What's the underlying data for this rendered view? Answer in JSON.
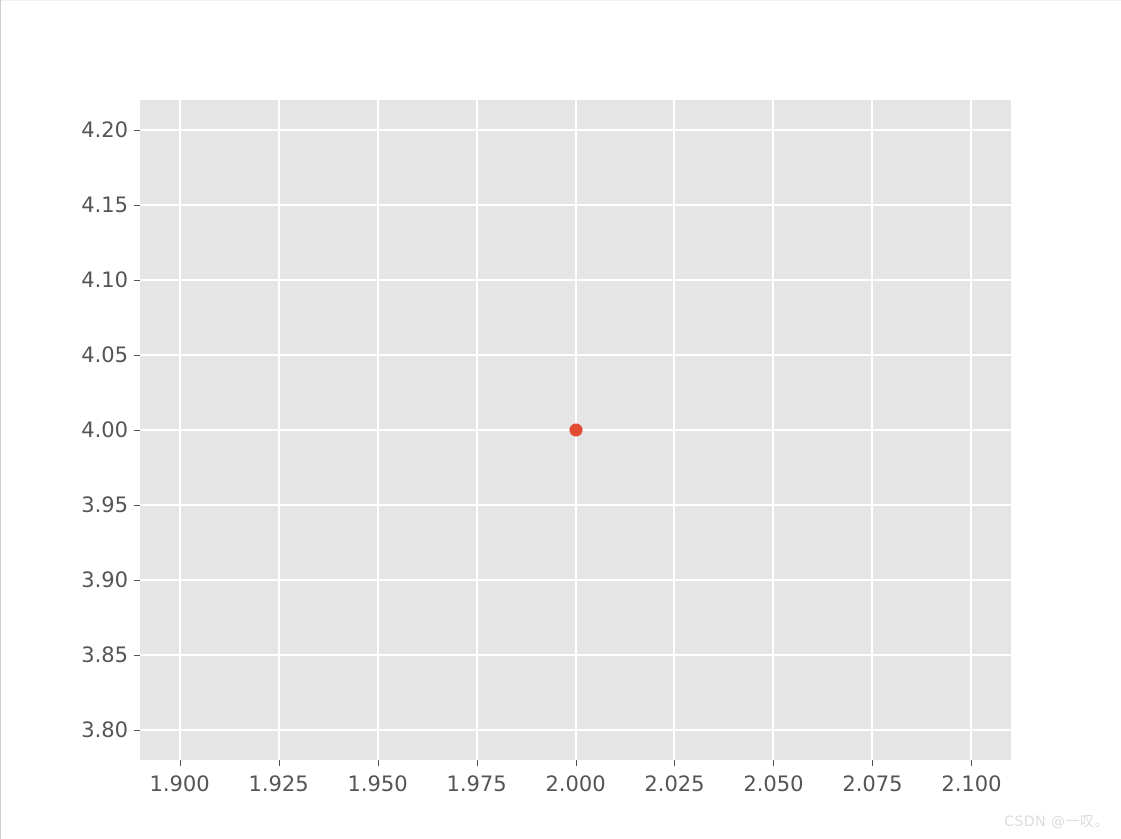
{
  "chart_data": {
    "type": "scatter",
    "x": [
      2.0
    ],
    "y": [
      4.0
    ],
    "xlim": [
      1.89,
      2.11
    ],
    "ylim": [
      3.78,
      4.22
    ],
    "x_ticks": [
      1.9,
      1.925,
      1.95,
      1.975,
      2.0,
      2.025,
      2.05,
      2.075,
      2.1
    ],
    "y_ticks": [
      3.8,
      3.85,
      3.9,
      3.95,
      4.0,
      4.05,
      4.1,
      4.15,
      4.2
    ],
    "x_tick_labels": [
      "1.900",
      "1.925",
      "1.950",
      "1.975",
      "2.000",
      "2.025",
      "2.050",
      "2.075",
      "2.100"
    ],
    "y_tick_labels": [
      "3.80",
      "3.85",
      "3.90",
      "3.95",
      "4.00",
      "4.05",
      "4.10",
      "4.15",
      "4.20"
    ],
    "title": "",
    "xlabel": "",
    "ylabel": "",
    "point_color": "#e24a33",
    "grid": true,
    "background": "#e5e5e5"
  },
  "watermark": "CSDN @一叹。"
}
